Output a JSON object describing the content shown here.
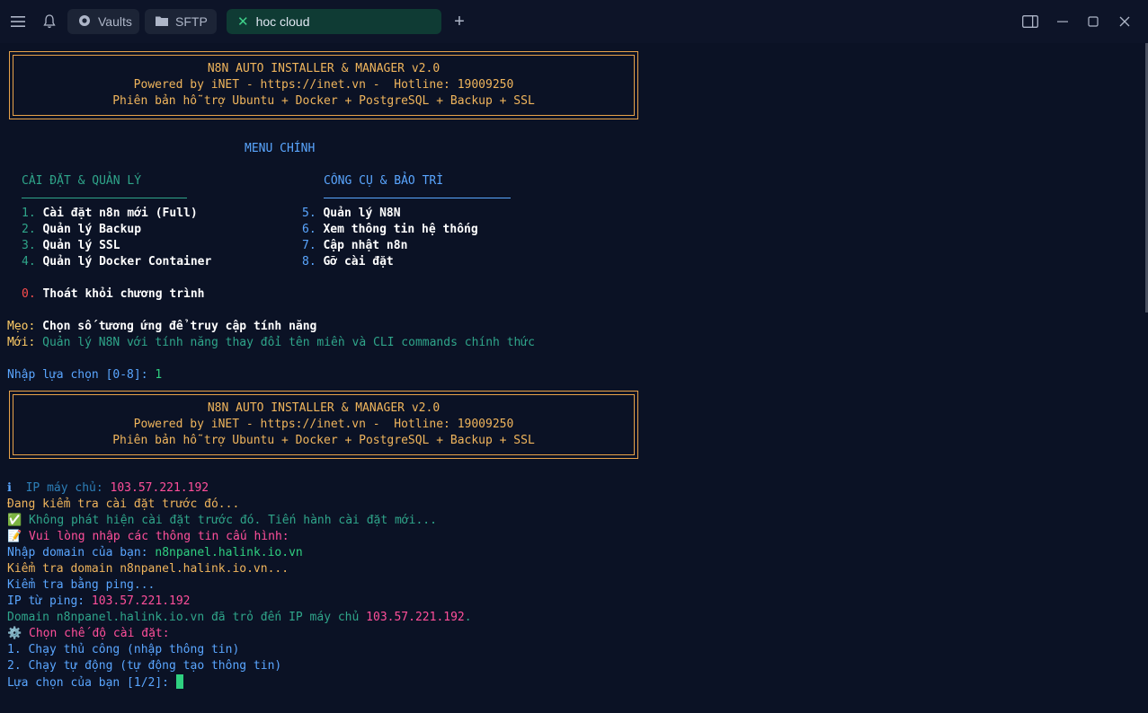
{
  "colors": {
    "orange": "#f0b55c",
    "blue": "#5aa6ff",
    "teal": "#2fa58a",
    "white": "#ffffff",
    "pink": "#ff4f9a",
    "red": "#ff4d4d",
    "yellow": "#ffcc66"
  },
  "titlebar": {
    "menu_icon": "menu-icon",
    "bell_icon": "bell-icon",
    "tabs": [
      {
        "label": "Vaults",
        "icon": "vault-icon"
      },
      {
        "label": "SFTP",
        "icon": "folder-icon"
      },
      {
        "label": "hoc cloud",
        "icon": "close-icon",
        "active": true
      }
    ],
    "new_tab": "+"
  },
  "banner": {
    "line1": "N8N AUTO INSTALLER & MANAGER v2.0",
    "line2": "Powered by iNET - https://inet.vn -  Hotline: 19009250",
    "line3": "Phiên bản hỗ trợ Ubuntu + Docker + PostgreSQL + Backup + SSL"
  },
  "menu": {
    "title": "MENU CHÍNH",
    "left_header": "CÀI ĐẶT & QUẢN LÝ",
    "right_header": "CÔNG CỤ & BẢO TRÌ",
    "left_items": [
      {
        "num": "1.",
        "label": "Cài đặt n8n mới (Full)"
      },
      {
        "num": "2.",
        "label": "Quản lý Backup"
      },
      {
        "num": "3.",
        "label": "Quản lý SSL"
      },
      {
        "num": "4.",
        "label": "Quản lý Docker Container"
      }
    ],
    "right_items": [
      {
        "num": "5.",
        "label": "Quản lý N8N"
      },
      {
        "num": "6.",
        "label": "Xem thông tin hệ thống"
      },
      {
        "num": "7.",
        "label": "Cập nhật n8n"
      },
      {
        "num": "8.",
        "label": "Gỡ cài đặt"
      }
    ],
    "exit_num": "0.",
    "exit_label": "Thoát khỏi chương trình",
    "tip_label": "Mẹo:",
    "tip_text": "Chọn số tương ứng để truy cập tính năng",
    "new_label": "Mới:",
    "new_text": "Quản lý N8N với tính năng thay đổi tên miền và CLI commands chính thức",
    "prompt": "Nhập lựa chọn [0-8]:",
    "answer": "1"
  },
  "output": {
    "ip_icon": "ℹ",
    "ip_label": "IP máy chủ:",
    "ip_value": "103.57.221.192",
    "checking": "Đang kiểm tra cài đặt trước đó...",
    "check_icon": "✅",
    "not_found": "Không phát hiện cài đặt trước đó. Tiến hành cài đặt mới...",
    "memo_icon": "📝",
    "enter_config": "Vui lòng nhập các thông tin cấu hình:",
    "domain_prompt": "Nhập domain của bạn:",
    "domain_value": "n8npanel.halink.io.vn",
    "check_domain": "Kiểm tra domain n8npanel.halink.io.vn...",
    "ping_check": "Kiểm tra bằng ping...",
    "ping_label": "IP từ ping:",
    "ping_value": "103.57.221.192",
    "domain_ok_text": "Domain n8npanel.halink.io.vn đã trỏ đến IP máy chủ",
    "domain_ok_ip": "103.57.221.192",
    "domain_ok_dot": ".",
    "gear_icon": "⚙️",
    "mode_title": "Chọn chế độ cài đặt:",
    "mode1": "1. Chạy thủ công (nhập thông tin)",
    "mode2": "2. Chạy tự động (tự động tạo thông tin)",
    "final_prompt": "Lựa chọn của bạn [1/2]:"
  }
}
